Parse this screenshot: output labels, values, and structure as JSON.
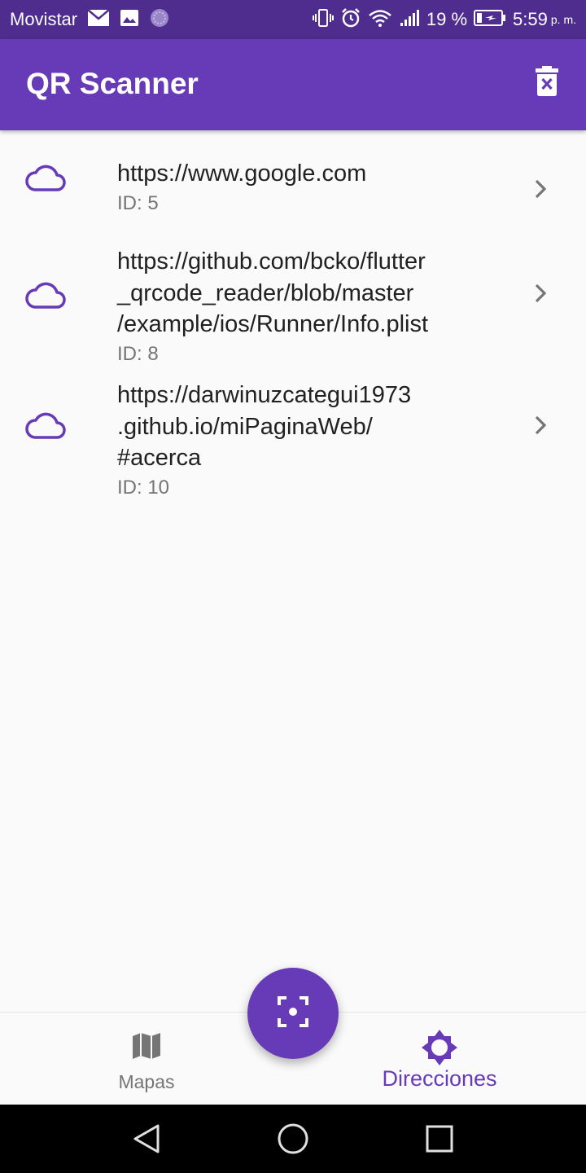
{
  "status_bar": {
    "carrier": "Movistar",
    "battery": "19 %",
    "time": "5:59",
    "ampm": "p. m."
  },
  "app_bar": {
    "title": "QR Scanner",
    "delete_icon": "delete-sweep-icon"
  },
  "scans": [
    {
      "icon": "cloud-icon",
      "url": "https://www.google.com",
      "subtitle": "ID: 5"
    },
    {
      "icon": "cloud-icon",
      "url": "https://github.com/bcko/flutter\n_qrcode_reader/blob/master\n/example/ios/Runner/Info.plist",
      "subtitle": "ID: 8"
    },
    {
      "icon": "cloud-icon",
      "url": "https://darwinuzcategui1973\n.github.io/miPaginaWeb/\n#acerca",
      "subtitle": "ID: 10"
    }
  ],
  "fab": {
    "icon": "center-focus-icon"
  },
  "bottom_nav": {
    "items": [
      {
        "label": "Mapas",
        "icon": "map-icon",
        "active": false
      },
      {
        "label": "Direcciones",
        "icon": "brightness-icon",
        "active": true
      }
    ]
  },
  "colors": {
    "primary": "#673ab7",
    "status_bar": "#4e2d8f",
    "background": "#fafafa"
  }
}
